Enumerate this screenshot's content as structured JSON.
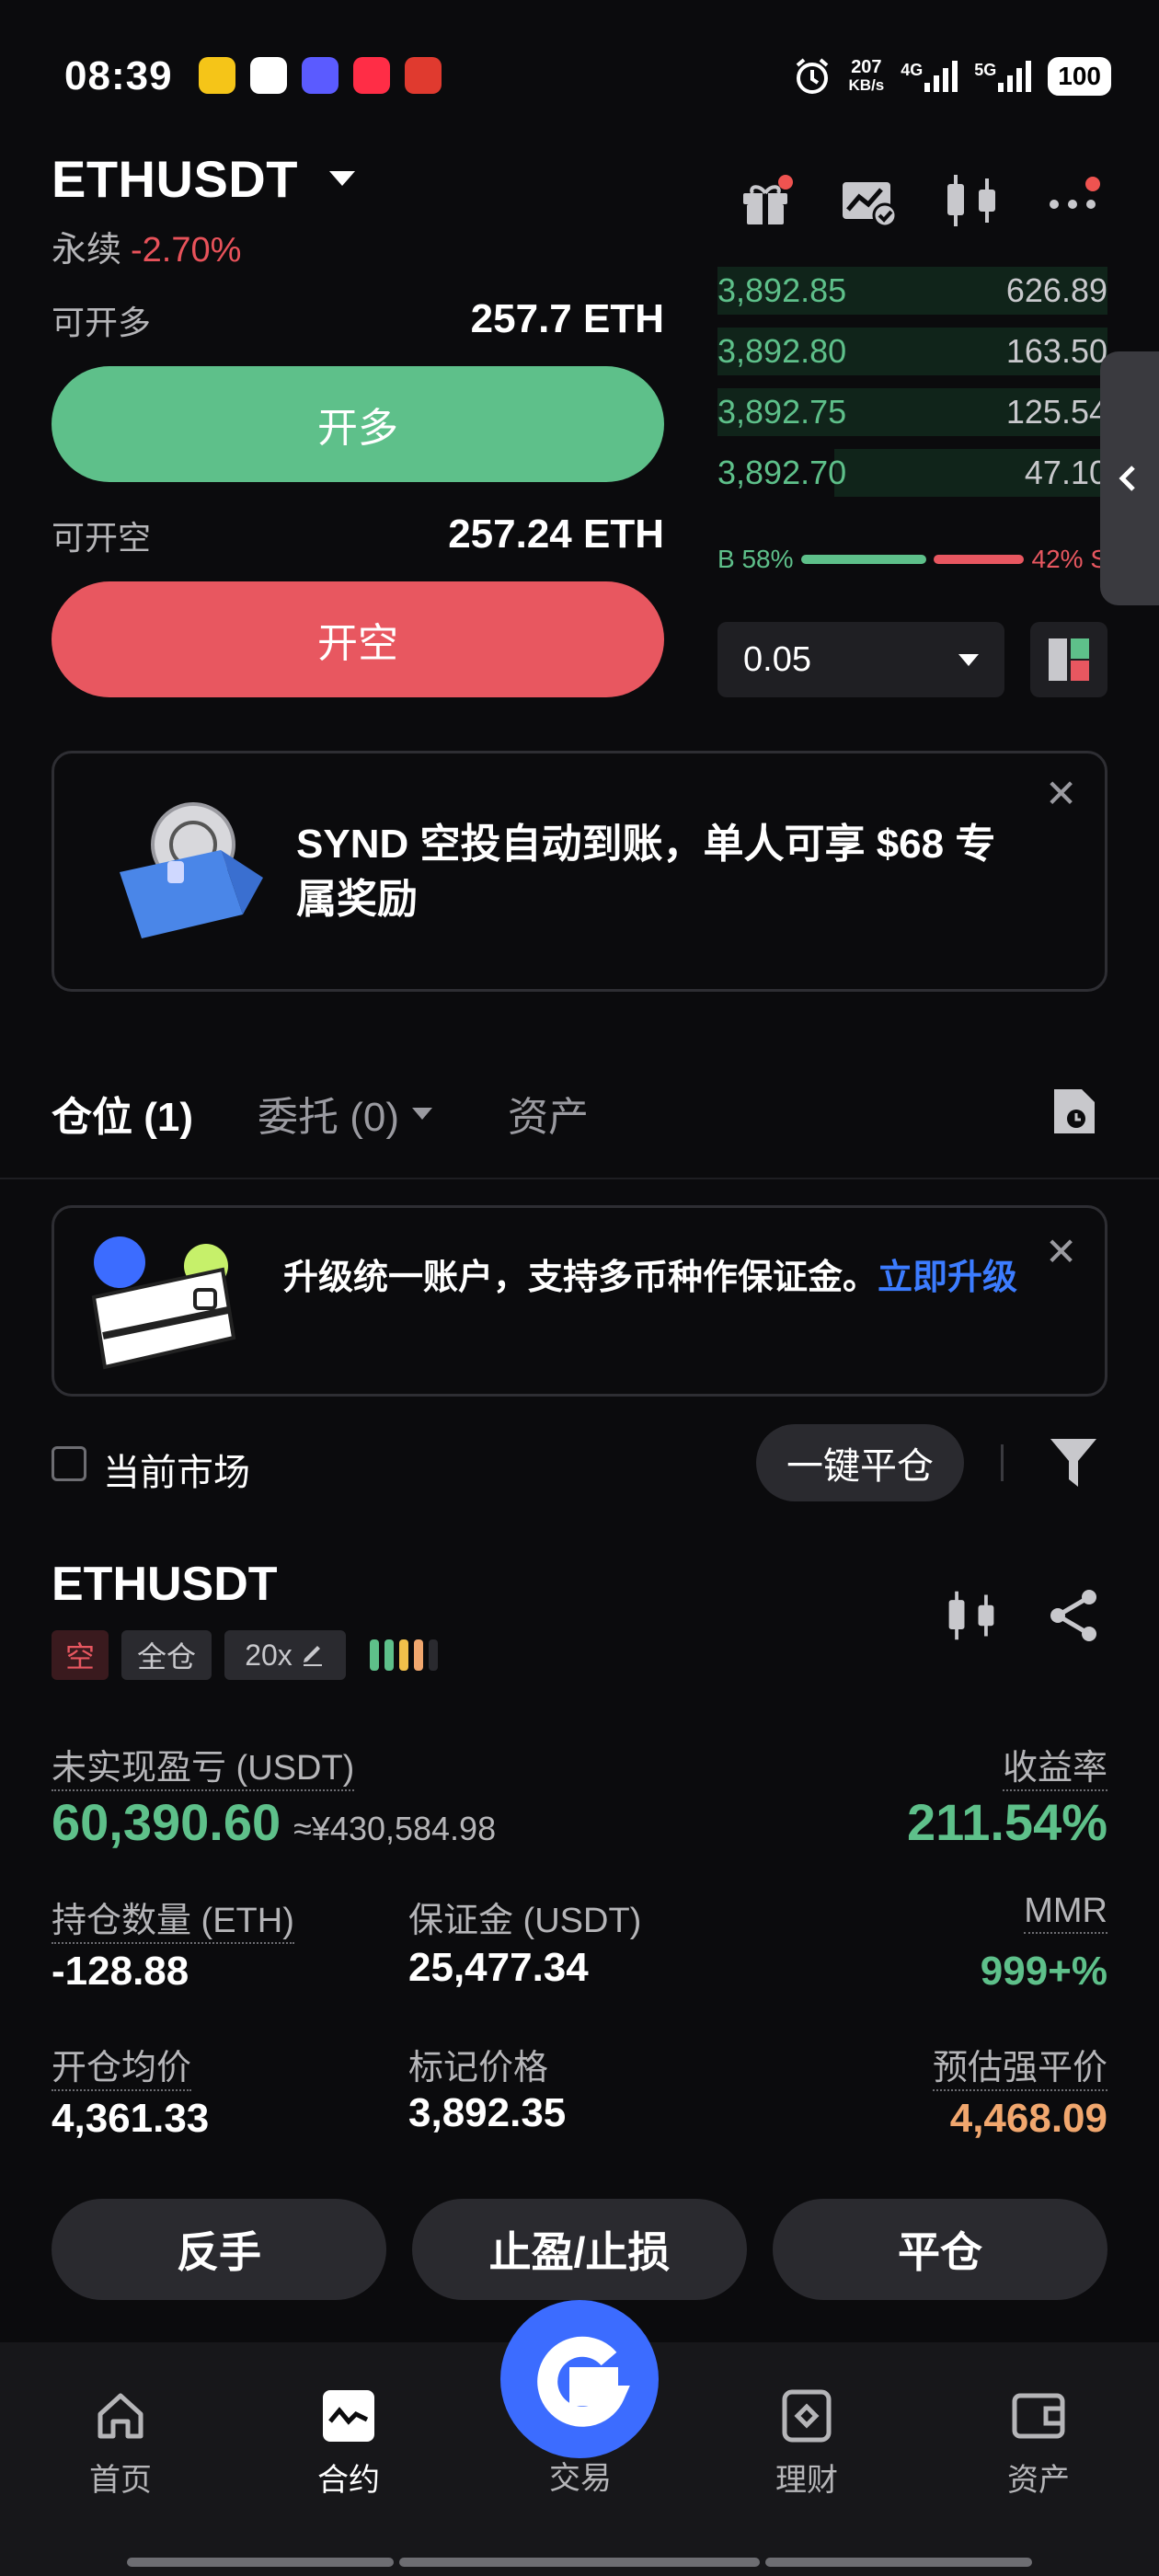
{
  "status_bar": {
    "time": "08:39",
    "net_speed": "207",
    "net_unit": "KB/s",
    "sig1": "4G",
    "sig2": "5G",
    "battery": "100"
  },
  "header": {
    "symbol": "ETHUSDT",
    "perpetual": "永续",
    "change": "-2.70%"
  },
  "trade": {
    "long_avail_label": "可开多",
    "long_avail_value": "257.7 ETH",
    "long_button": "开多",
    "short_avail_label": "可开空",
    "short_avail_value": "257.24 ETH",
    "short_button": "开空"
  },
  "orderbook": {
    "bids": [
      {
        "price": "3,892.85",
        "qty": "626.89"
      },
      {
        "price": "3,892.80",
        "qty": "163.50"
      },
      {
        "price": "3,892.75",
        "qty": "125.54"
      },
      {
        "price": "3,892.70",
        "qty": "47.10"
      }
    ],
    "buy_ratio": "B 58%",
    "sell_ratio": "42% S",
    "buy_fraction": 0.58,
    "step": "0.05"
  },
  "promo": {
    "text": "SYND 空投自动到账，单人可享 $68 专属奖励"
  },
  "tabs": {
    "positions": "仓位 (1)",
    "orders": "委托 (0)",
    "assets": "资产"
  },
  "upgrade": {
    "text": "升级统一账户，支持多币种作保证金。",
    "link": "立即升级"
  },
  "filter": {
    "current_market": "当前市场",
    "close_all": "一键平仓"
  },
  "position": {
    "symbol": "ETHUSDT",
    "side": "空",
    "margin_mode": "全仓",
    "leverage": "20x",
    "upnl_label": "未实现盈亏 (USDT)",
    "upnl_value": "60,390.60",
    "upnl_cny": "≈¥430,584.98",
    "roe_label": "收益率",
    "roe_value": "211.54%",
    "size_label": "持仓数量 (ETH)",
    "size_value": "-128.88",
    "margin_label": "保证金 (USDT)",
    "margin_value": "25,477.34",
    "mmr_label": "MMR",
    "mmr_value": "999+%",
    "entry_label": "开仓均价",
    "entry_value": "4,361.33",
    "mark_label": "标记价格",
    "mark_value": "3,892.35",
    "liq_label": "预估强平价",
    "liq_value": "4,468.09",
    "actions": {
      "reverse": "反手",
      "tpsl": "止盈/止损",
      "close": "平仓"
    }
  },
  "nav": {
    "home": "首页",
    "contract": "合约",
    "trade": "交易",
    "finance": "理财",
    "assets": "资产"
  },
  "colors": {
    "green": "#5ec08a",
    "red": "#e85760",
    "blue": "#3c6cff",
    "orange": "#f1a76e"
  }
}
